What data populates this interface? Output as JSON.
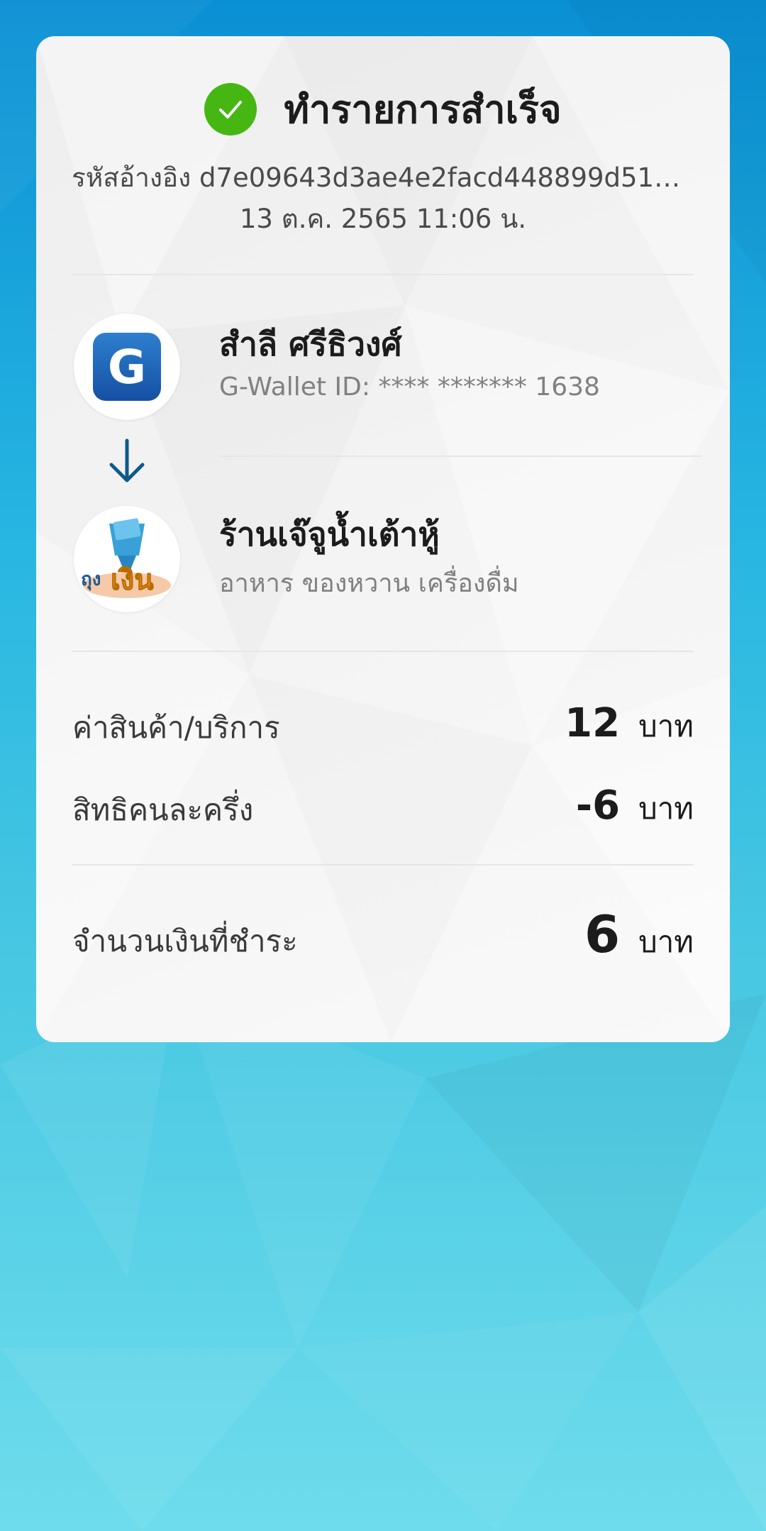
{
  "status": {
    "title": "ทำรายการสำเร็จ",
    "color": "#46b613"
  },
  "reference": "รหัสอ้างอิง d7e09643d3ae4e2facd448899d51b...",
  "datetime": "13 ต.ค. 2565 11:06 น.",
  "payer": {
    "name": "สำลี ศรีธิวงศ์",
    "wallet_id": "G-Wallet ID: **** ******* 1638",
    "logo_letter": "G",
    "logo_icon": "g-wallet-logo"
  },
  "payee": {
    "name": "ร้านเจ๊จูน้ำเต้าหู้",
    "category": "อาหาร ของหวาน เครื่องดื่ม",
    "logo_text_1": "ถุง",
    "logo_text_2": "เงิน",
    "logo_icon": "thung-ngoen-logo"
  },
  "breakdown": {
    "price_label": "ค่าสินค้า/บริการ",
    "price_value": "12",
    "price_unit": "บาท",
    "discount_label": "สิทธิคนละครึ่ง",
    "discount_value": "-6",
    "discount_unit": "บาท",
    "total_label": "จำนวนเงินที่ชำระ",
    "total_value": "6",
    "total_unit": "บาท"
  },
  "colors": {
    "accent_blue": "#1550a3",
    "arrow": "#0d5a8a"
  }
}
